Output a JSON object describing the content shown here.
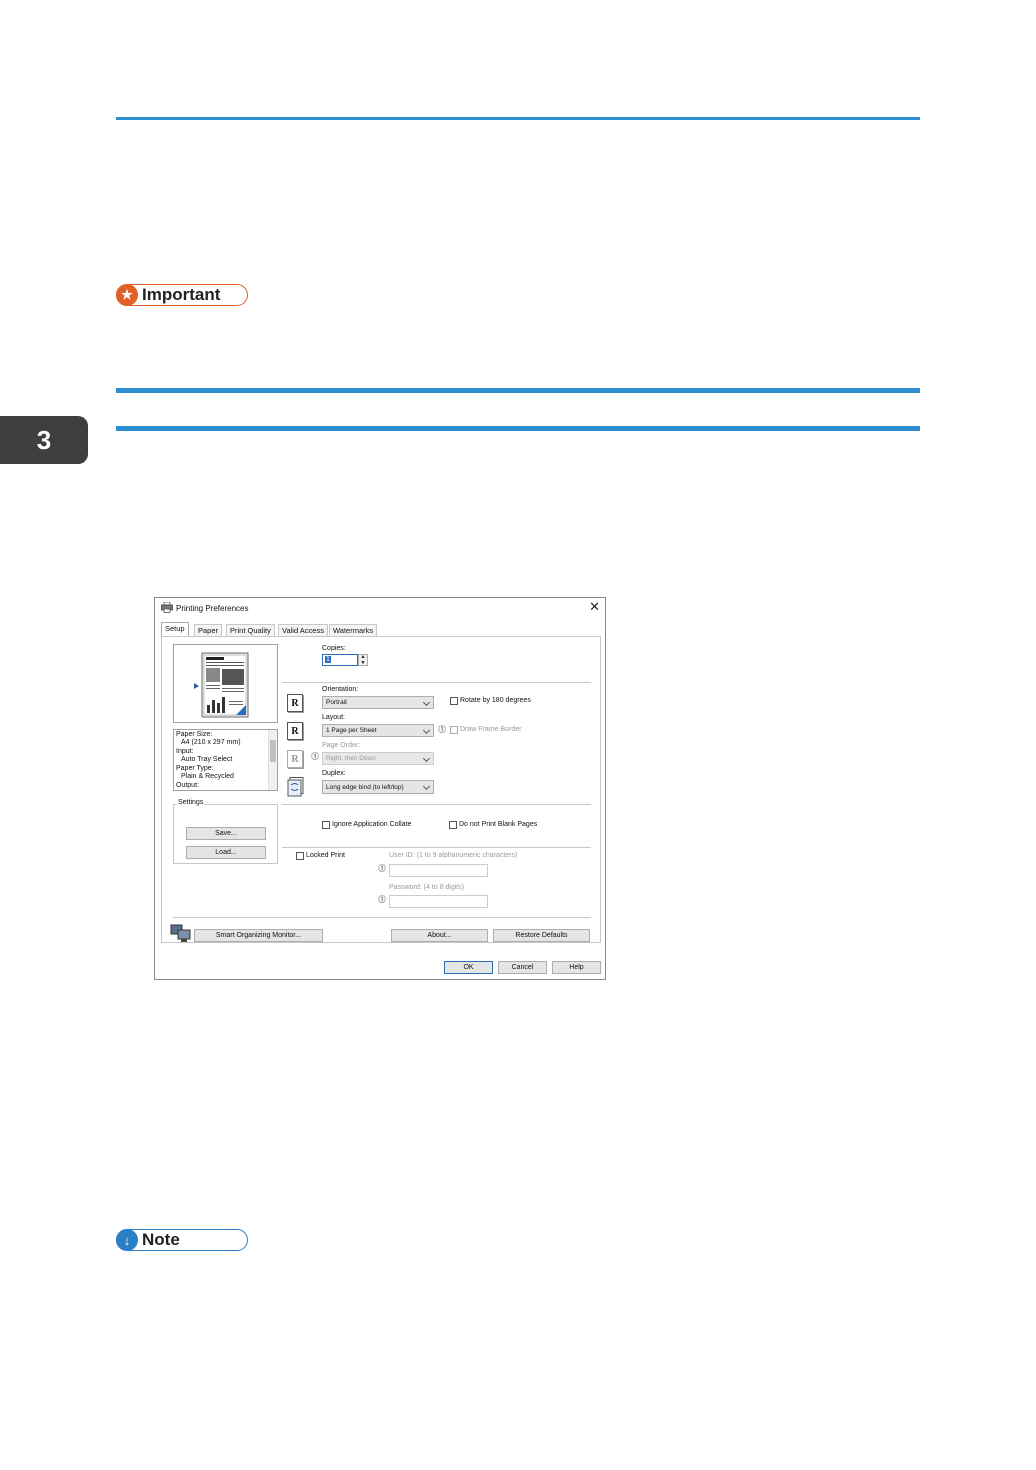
{
  "chapter_tab": "3",
  "important_label": "Important",
  "note_label": "Note",
  "colors": {
    "rule": "#2d8fd0",
    "important": "#e0602a",
    "note": "#2a7fc6",
    "chapter_tab": "#3f3f3f"
  },
  "dialog": {
    "title": "Printing Preferences",
    "tabs": [
      "Setup",
      "Paper",
      "Print Quality",
      "Valid Access",
      "Watermarks"
    ],
    "active_tab": "Setup",
    "summary": {
      "lines": [
        "Paper Size:",
        "A4 (210 x 297 mm)",
        "Input:",
        "Auto Tray Select",
        "Paper Type:",
        "Plain & Recycled",
        "Output:"
      ]
    },
    "settings_group": "Settings",
    "save_button": "Save...",
    "load_button": "Load...",
    "copies_label": "Copies:",
    "copies_value": "1",
    "orientation_label": "Orientation:",
    "orientation_value": "Portrait",
    "rotate_label": "Rotate by 180 degrees",
    "layout_label": "Layout:",
    "layout_value": "1 Page per Sheet",
    "draw_frame_label": "Draw Frame Border",
    "page_order_label": "Page Order:",
    "page_order_value": "Right, then Down",
    "duplex_label": "Duplex:",
    "duplex_value": "Long edge bind (to left/top)",
    "ignore_collate_label": "Ignore Application Collate",
    "no_blank_label": "Do not Print Blank Pages",
    "locked_print_label": "Locked Print",
    "user_id_label": "User ID: (1 to 9 alphanumeric characters)",
    "password_label": "Password: (4 to 8 digits)",
    "smart_monitor_button": "Smart Organizing Monitor...",
    "about_button": "About...",
    "restore_button": "Restore Defaults",
    "ok_button": "OK",
    "cancel_button": "Cancel",
    "help_button": "Help"
  }
}
